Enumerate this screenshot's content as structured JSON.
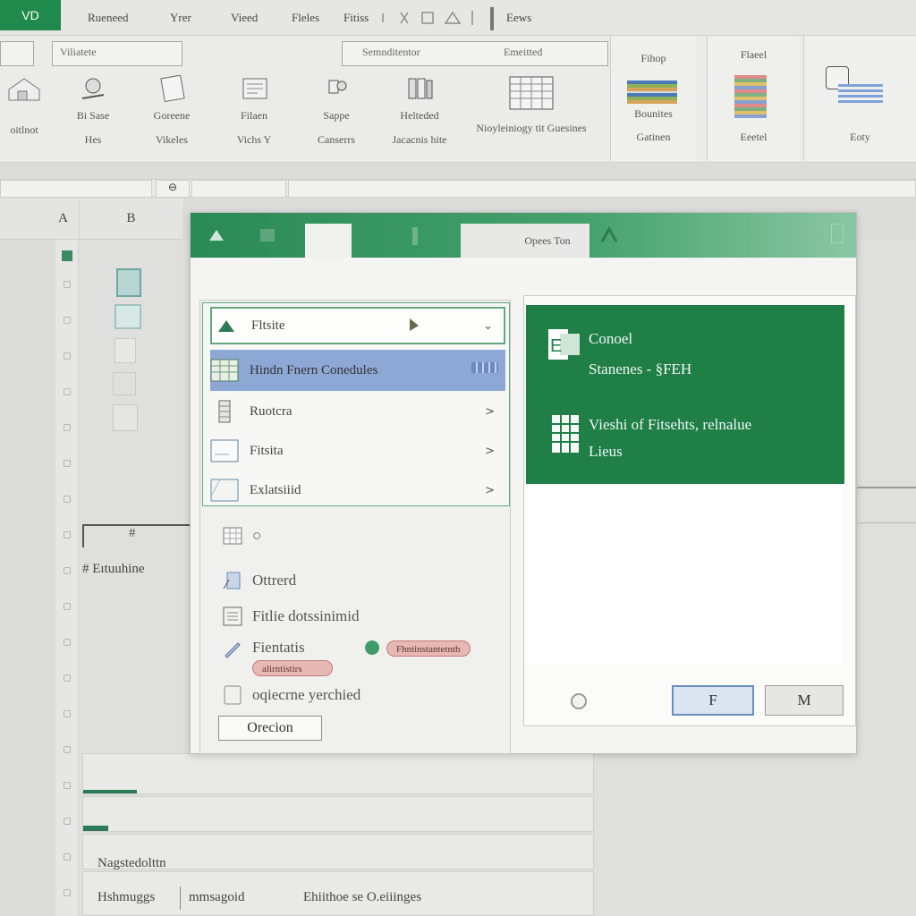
{
  "app": {
    "badge": "VD"
  },
  "menu": {
    "items": [
      "Rueneed",
      "Yrer",
      "Vieed",
      "Fleles",
      "Fitiss",
      "Eews"
    ]
  },
  "ribbon": {
    "field_left": "Viliatete",
    "field_mid": "Semnditentor",
    "field_right": "Emeitted",
    "buttons": [
      {
        "top": "",
        "bottom": "oitlnot"
      },
      {
        "top": "Bi Sase",
        "bottom": "Hes"
      },
      {
        "top": "Goreene",
        "bottom": "Vikeles"
      },
      {
        "top": "Filaen",
        "bottom": "Vichs Y"
      },
      {
        "top": "Sappe",
        "bottom": "Canserrs"
      },
      {
        "top": "Helteded",
        "bottom": "Jacacnis hite"
      },
      {
        "top": "",
        "bottom": "Nioyleiniogy tit Guesines"
      }
    ],
    "groups": [
      {
        "title": "Fihop",
        "label1": "Bounites",
        "label2": "Gatinen"
      },
      {
        "title": "Flaeel",
        "label1": "",
        "label2": "Eeetel"
      },
      {
        "title": "",
        "label1": "",
        "label2": "Eoty"
      }
    ]
  },
  "formula_bar": {
    "name_box": "⊖"
  },
  "columns": [
    "A",
    "B"
  ],
  "sheet": {
    "row_label_1": "#",
    "row_label_2": "# Eıtuuhine"
  },
  "dialog": {
    "tab_active": "Opees Ton",
    "list": [
      {
        "label": "Fltsite",
        "trailing": "⌄"
      },
      {
        "label": "Hindn Fnern Conedules",
        "trailing": ""
      },
      {
        "label": "Ruotcra",
        "trailing": ">"
      },
      {
        "label": "Fitsita",
        "trailing": ">"
      },
      {
        "label": "Exlatsiiid",
        "trailing": ">"
      }
    ],
    "options": [
      {
        "label": "○"
      },
      {
        "label": "Ottrerd"
      },
      {
        "label": "Fitlie dotssinimid"
      },
      {
        "label": "Fientatis",
        "pill1": "Fhntinstantetnth",
        "pill2": "alirntistirs"
      },
      {
        "label": "oqiecrne yerchied"
      }
    ],
    "left_button": "Orecion",
    "card": {
      "line1": "Conoel",
      "line2": "Stanenes - §FEH",
      "line3": "Vieshi of Fitsehts, relnalue",
      "line4": "Lieus"
    },
    "buttons": {
      "f": "F",
      "m": "M"
    }
  },
  "bottom": {
    "label": "Nagstedolttn",
    "status1": "Hshmuggs",
    "status2": "mmsagoid",
    "status3": "Ehiithoe se O.eiiinges"
  },
  "colors": {
    "excel_green": "#1f7f47",
    "selected_row": "#8ea8d6"
  }
}
